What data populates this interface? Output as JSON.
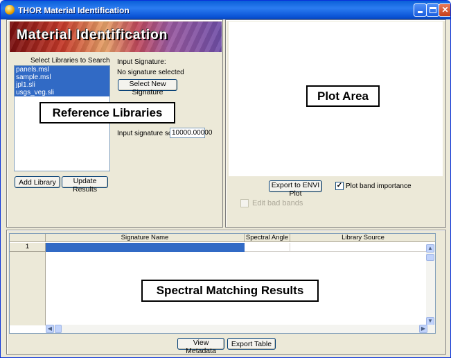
{
  "window": {
    "title": "THOR Material Identification"
  },
  "libraries": {
    "banner_title": "Material Identification",
    "select_label": "Select Libraries to Search",
    "items": [
      "panels.msl",
      "sample.msl",
      "jpl1.sli",
      "usgs_veg.sli"
    ],
    "add_button": "Add Library",
    "update_button": "Update Results",
    "callout": "Reference Libraries"
  },
  "signature": {
    "input_label": "Input Signature:",
    "status": "No signature selected",
    "select_button": "Select New Signature",
    "scale_label": "Input signature scale:",
    "scale_value": "10000.00000"
  },
  "plot": {
    "callout": "Plot Area",
    "export_button": "Export to ENVI Plot",
    "band_importance_label": "Plot band importance",
    "band_importance_checked": true,
    "edit_bad_bands_label": "Edit bad bands",
    "edit_bad_bands_checked": false
  },
  "results": {
    "columns": [
      "Signature Name",
      "Spectral Angle",
      "Library Source"
    ],
    "row_number": "1",
    "callout": "Spectral Matching Results",
    "view_metadata_button": "View Metadata",
    "export_table_button": "Export Table"
  },
  "colors": {
    "selection": "#316ac5",
    "titlebar": "#0a5fd8"
  }
}
